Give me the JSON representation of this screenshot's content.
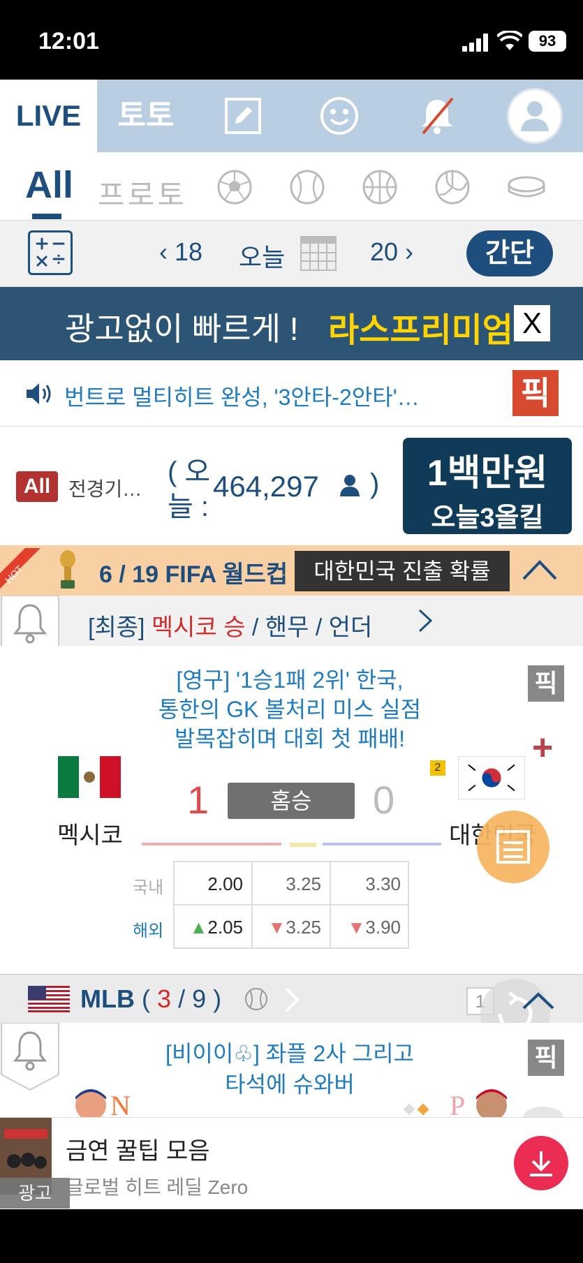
{
  "status_bar": {
    "time": "12:01",
    "battery": "93"
  },
  "top_nav": {
    "live_label": "LIVE",
    "toto_label": "토토",
    "icons": [
      "edit-icon",
      "smiley-icon",
      "bell-off-icon",
      "profile-icon"
    ]
  },
  "sport_tabs": {
    "all_label": "All",
    "proto_label": "프로토",
    "icons": [
      "soccer-icon",
      "baseball-icon",
      "basketball-icon",
      "volleyball-icon",
      "hockey-icon"
    ]
  },
  "date_row": {
    "prev_date": "18",
    "today_label": "오늘",
    "next_date": "20",
    "mode_button": "간단"
  },
  "promo": {
    "text": "광고없이 빠르게 !",
    "highlight": "라스프리미엄",
    "close_label": "X"
  },
  "news": {
    "text": "번트로 멀티히트 완성, '3안타-2안타'…",
    "pick_label": "픽"
  },
  "stats": {
    "all_badge": "All",
    "label": "전경기…",
    "open_paren": "( 오",
    "today_label": "늘 :",
    "count": "464,297",
    "close_paren": ")"
  },
  "ad_1m": {
    "line1": "1백만원",
    "line2": "오늘3올킬"
  },
  "hot_match": {
    "hot_label": "HOT",
    "title": "6 / 19  FIFA 월드컵",
    "tooltip": "대한민국 진출 확률"
  },
  "result_row": {
    "prefix": "[최종]",
    "winner": "멕시코 승",
    "rest": " / 핸무 / 언더"
  },
  "match": {
    "headline_lines": [
      "[영구] '1승1패 2위' 한국,",
      "통한의 GK 볼처리 미스 실점",
      "발목잡히며 대회 첫 패배!"
    ],
    "pick_label": "픽",
    "plus_label": "+",
    "home_team": "멕시코",
    "away_team": "대한민국",
    "away_rank": "2",
    "home_score": "1",
    "away_score": "0",
    "status": "홈승",
    "odds": {
      "domestic_label": "국내",
      "foreign_label": "해외",
      "domestic": [
        "2.00",
        "3.25",
        "3.30"
      ],
      "foreign": [
        "2.05",
        "3.25",
        "3.90"
      ]
    }
  },
  "mlb": {
    "name": "MLB",
    "open": "(",
    "live_count": "3",
    "sep": "/",
    "total": "9",
    "close": ")",
    "badge": "1"
  },
  "mlb_match": {
    "headline_lines": [
      "[비이이♧] 좌플 2사 그리고",
      "타석에 슈와버"
    ],
    "pick_label": "픽"
  },
  "bottom_ad": {
    "title": "금연 꿀팁 모음",
    "subtitle": "글로벌 히트 레딜 Zero",
    "ad_tag": "광고"
  },
  "colors": {
    "brand": "#1d4e7d",
    "promo_bg": "#2c5575",
    "highlight": "#ffd400",
    "pick": "#d84a2f",
    "hot_bg": "#f9cfa4"
  }
}
